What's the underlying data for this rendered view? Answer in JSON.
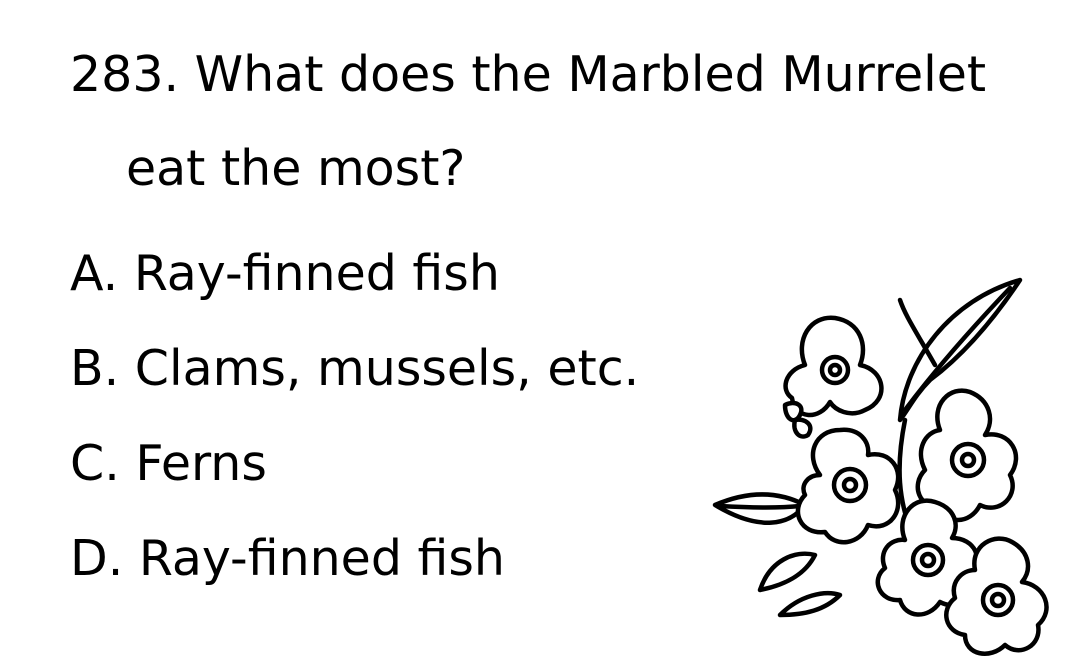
{
  "question": {
    "line1": "283. What does the Marbled Murrelet",
    "line2": "eat the most?"
  },
  "choices": [
    {
      "letter": "A.",
      "text": "Ray-finned fish"
    },
    {
      "letter": "B.",
      "text": "Clams, mussels, etc."
    },
    {
      "letter": "C.",
      "text": "Ferns"
    },
    {
      "letter": "D.",
      "text": "Ray-finned fish"
    }
  ],
  "illustration": {
    "icon": "flower-bouquet-icon"
  }
}
